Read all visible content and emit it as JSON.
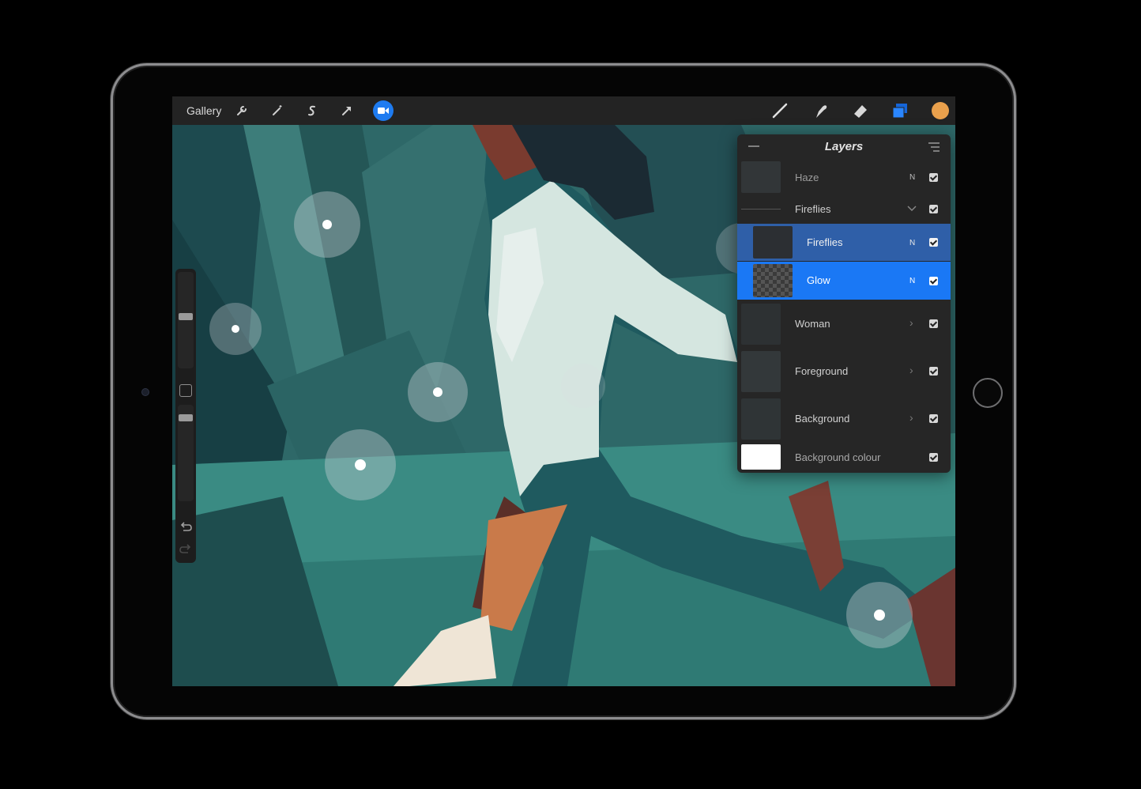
{
  "toolbar": {
    "gallery_label": "Gallery",
    "left_icons": [
      "wrench-icon",
      "magic-wand-icon",
      "selection-s-icon",
      "transform-arrow-icon",
      "video-record-icon"
    ],
    "right_icons": [
      "brush-icon",
      "smudge-icon",
      "eraser-icon",
      "layers-icon",
      "color-swatch"
    ],
    "current_color": "#e9a04c",
    "accent": "#1e7bf0"
  },
  "layers_panel": {
    "title": "Layers",
    "layers": [
      {
        "name": "Haze",
        "mode": "N",
        "visible": true
      },
      {
        "name": "Fireflies",
        "group": true,
        "expanded": true,
        "visible": true
      },
      {
        "name": "Fireflies",
        "mode": "N",
        "visible": true,
        "selected_secondary": true
      },
      {
        "name": "Glow",
        "mode": "N",
        "visible": true,
        "selected": true
      },
      {
        "name": "Woman",
        "group": true,
        "visible": true
      },
      {
        "name": "Foreground",
        "group": true,
        "visible": true
      },
      {
        "name": "Background",
        "group": true,
        "visible": true
      },
      {
        "name": "Background colour",
        "visible": true
      }
    ]
  },
  "sidebar": {
    "brush_size_level": 0.45,
    "opacity_level": 0.1
  }
}
